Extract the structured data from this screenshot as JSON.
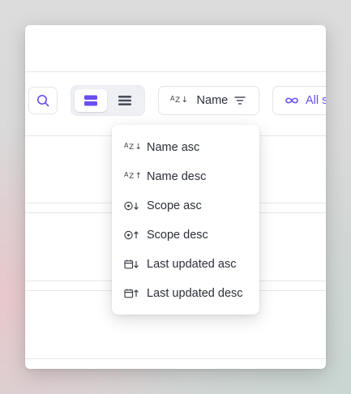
{
  "toolbar": {
    "search_icon": "search-icon",
    "view_modes": [
      {
        "name": "card-view",
        "icon": "cards-icon",
        "active": true
      },
      {
        "name": "list-view",
        "icon": "list-icon",
        "active": false
      }
    ],
    "sort_label": "Name",
    "scope_label": "All s"
  },
  "sort_menu": {
    "items": [
      {
        "label": "Name asc",
        "icon": "sort-alpha-down-icon"
      },
      {
        "label": "Name desc",
        "icon": "sort-alpha-up-icon"
      },
      {
        "label": "Scope asc",
        "icon": "scope-down-icon"
      },
      {
        "label": "Scope desc",
        "icon": "scope-up-icon"
      },
      {
        "label": "Last updated asc",
        "icon": "calendar-down-icon"
      },
      {
        "label": "Last updated desc",
        "icon": "calendar-up-icon"
      }
    ]
  },
  "colors": {
    "accent": "#6b4ef0",
    "text": "#2b2f38",
    "border": "#e3e5ea"
  }
}
